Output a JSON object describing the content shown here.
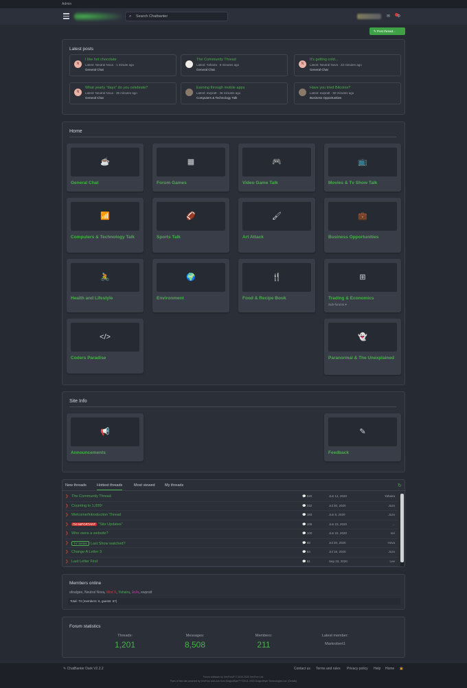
{
  "admin_label": "Admin",
  "search": {
    "placeholder": "Search Chatbanter"
  },
  "post_thread_label": "Post thread...",
  "latest": {
    "title": "Latest posts",
    "items": [
      {
        "title": "I like hot chocolate",
        "meta": "Latest: Neutral Nova · 1 minute ago",
        "forum": "General Chat",
        "avatar": "N"
      },
      {
        "title": "The Community Thread",
        "meta": "Latest: Yahaira · 8 minutes ago",
        "forum": "General Chat",
        "avatar": ""
      },
      {
        "title": "It's getting cold...",
        "meta": "Latest: Neutral Nova · 22 minutes ago",
        "forum": "General Chat",
        "avatar": "N"
      },
      {
        "title": "What yearly \"days\" do you celebrate?",
        "meta": "Latest: Neutral Nova · 35 minutes ago",
        "forum": "General Chat",
        "avatar": "N"
      },
      {
        "title": "Earning through mobile apps",
        "meta": "Latest: ewpratt · 46 minutes ago",
        "forum": "Computers & Technology Talk",
        "avatar": ""
      },
      {
        "title": "Have you tried Bitcoins?",
        "meta": "Latest: ewpratt · 50 minutes ago",
        "forum": "Business Opportunities",
        "avatar": ""
      }
    ]
  },
  "home": {
    "title": "Home",
    "nodes": [
      {
        "name": "General Chat",
        "icon": "☕",
        "icon_name": "coffee-cup-icon"
      },
      {
        "name": "Forum Games",
        "icon": "▦",
        "icon_name": "chessboard-icon"
      },
      {
        "name": "Video Game Talk",
        "icon": "🎮",
        "icon_name": "gamepad-icon"
      },
      {
        "name": "Movies & Tv Show Talk",
        "icon": "📺",
        "icon_name": "tv-icon"
      },
      {
        "name": "Computers & Technology Talk",
        "icon": "📶",
        "icon_name": "wifi-icon"
      },
      {
        "name": "Sports Talk",
        "icon": "🏈",
        "icon_name": "football-icon"
      },
      {
        "name": "Art Attack",
        "icon": "🖌",
        "icon_name": "paintbrush-icon"
      },
      {
        "name": "Business Opportunities",
        "icon": "💼",
        "icon_name": "briefcase-clock-icon"
      },
      {
        "name": "Health and Lifestyle",
        "icon": "🚴",
        "icon_name": "cyclist-icon"
      },
      {
        "name": "Environment",
        "icon": "🌍",
        "icon_name": "globe-icon"
      },
      {
        "name": "Food & Recipe Book",
        "icon": "🍴",
        "icon_name": "utensils-icon"
      },
      {
        "name": "Trading & Economics",
        "icon": "⊞",
        "icon_name": "grid-icon",
        "sub": "Sub-forums ▾"
      },
      {
        "name": "Coders Paradise",
        "icon": "</>",
        "icon_name": "code-icon"
      },
      {
        "name": "Paranormal & The Unexplained",
        "icon": "👻",
        "icon_name": "ghost-icon"
      }
    ]
  },
  "siteinfo": {
    "title": "Site Info",
    "nodes": [
      {
        "name": "Announcements",
        "icon": "📢",
        "icon_name": "megaphone-icon"
      },
      {
        "name": "Feedback",
        "icon": "✎",
        "icon_name": "pencil-icon"
      }
    ]
  },
  "threads": {
    "tabs": [
      "New threads",
      "Hottest threads",
      "Most viewed",
      "My threads"
    ],
    "rows": [
      {
        "prefix": "",
        "prefix_style": "",
        "title": "The Community Thread",
        "replies": "520",
        "date": "Jun 14, 2020",
        "user": "Yahaira"
      },
      {
        "prefix": "",
        "prefix_style": "",
        "title": "Counting to 1,000!",
        "replies": "232",
        "date": "Jul 30, 2020",
        "user": "JoJo"
      },
      {
        "prefix": "",
        "prefix_style": "",
        "title": "Welcome/Introduction Thread",
        "replies": "183",
        "date": "Jun 8, 2020",
        "user": "JoJo"
      },
      {
        "prefix": "I'M IMPORTANT",
        "prefix_style": "red",
        "title": "\"Site Updates\"",
        "replies": "108",
        "date": "Jun 23, 2020",
        "user": "..."
      },
      {
        "prefix": "",
        "prefix_style": "",
        "title": "Who owns a website?",
        "replies": "100",
        "date": "Jun 24, 2020",
        "user": "Iori"
      },
      {
        "prefix": "TV Series",
        "prefix_style": "out",
        "title": "Last Show watched?",
        "replies": "68",
        "date": "Jul 20, 2020",
        "user": "Hova"
      },
      {
        "prefix": "",
        "prefix_style": "",
        "title": "Change A Letter 3",
        "replies": "64",
        "date": "Jul 16, 2020",
        "user": "JoJo"
      },
      {
        "prefix": "",
        "prefix_style": "",
        "title": "Last Letter First",
        "replies": "61",
        "date": "Sep 23, 2020",
        "user": "Lee"
      }
    ]
  },
  "members": {
    "title": "Members online",
    "list": [
      {
        "name": "afoalgee",
        "color": "#9aa0aa"
      },
      {
        "name": "Neutral Nova",
        "color": "#9aa0aa"
      },
      {
        "name": "Mod X",
        "color": "#d23b3b"
      },
      {
        "name": "Yahaira",
        "color": "#4cae4f"
      },
      {
        "name": "JoJo",
        "color": "#d13fb0"
      },
      {
        "name": "ewpratt",
        "color": "#9aa0aa"
      }
    ],
    "total": "Total: 73 (members: 6, guests: 67)"
  },
  "stats": {
    "title": "Forum statistics",
    "threads_label": "Threads:",
    "threads": "1,201",
    "messages_label": "Messages:",
    "messages": "8,508",
    "members_label": "Members:",
    "members": "211",
    "latest_label": "Latest member:",
    "latest": "Markrobert1"
  },
  "footer": {
    "style": "ChatBanter Dark V2.2.2",
    "links": [
      "Contact us",
      "Terms and rules",
      "Privacy policy",
      "Help",
      "Home"
    ],
    "line1": "Forum software by XenForo® © 2010-2020 XenForo Ltd.",
    "line2": "Parts of this site powered by XenForo add-ons from DragonByte™ ©2011-2020 DragonByte Technologies Ltd. (Details)"
  }
}
